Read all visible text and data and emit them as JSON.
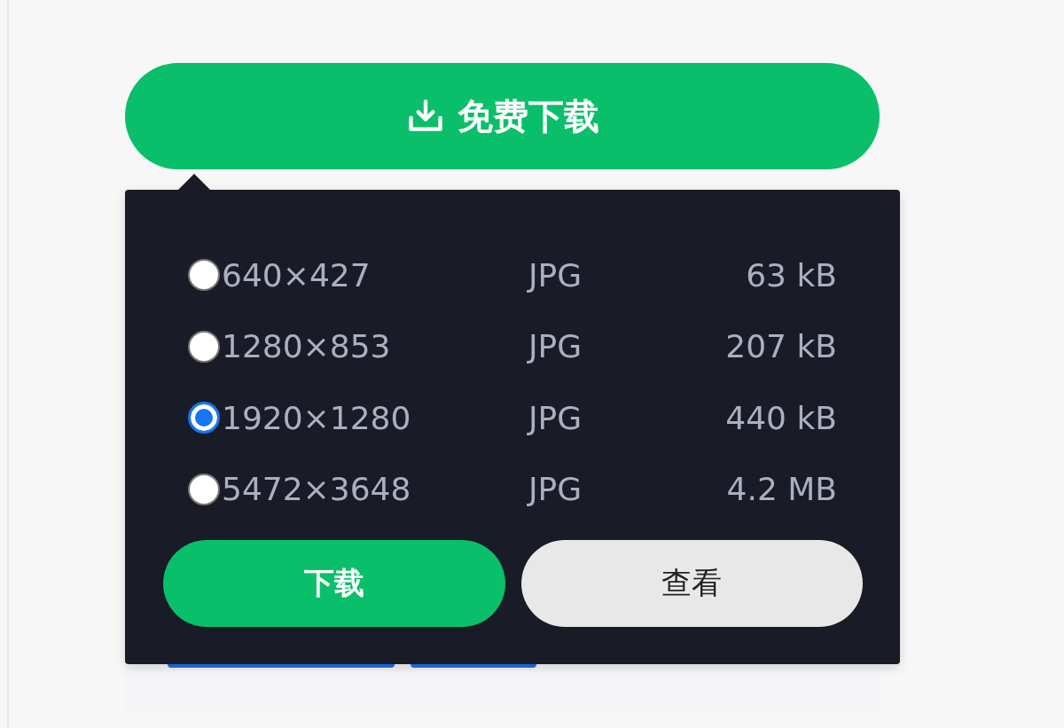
{
  "download_button": {
    "label": "免费下载"
  },
  "options": [
    {
      "resolution": "640×427",
      "format": "JPG",
      "size": "63 kB",
      "selected": false
    },
    {
      "resolution": "1280×853",
      "format": "JPG",
      "size": "207 kB",
      "selected": false
    },
    {
      "resolution": "1920×1280",
      "format": "JPG",
      "size": "440 kB",
      "selected": true
    },
    {
      "resolution": "5472×3648",
      "format": "JPG",
      "size": "4.2 MB",
      "selected": false
    }
  ],
  "actions": [
    {
      "label": "下载",
      "kind": "primary"
    },
    {
      "label": "查看",
      "kind": "secondary"
    }
  ]
}
